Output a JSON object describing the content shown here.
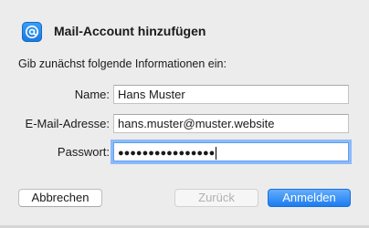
{
  "dialog": {
    "icon": "mail-at-icon",
    "title": "Mail-Account hinzufügen",
    "subtitle": "Gib zunächst folgende Informationen ein:"
  },
  "form": {
    "name_label": "Name:",
    "name_value": "Hans Muster",
    "email_label": "E-Mail-Adresse:",
    "email_value": "hans.muster@muster.website",
    "password_label": "Passwort:",
    "password_masked": "●●●●●●●●●●●●●●●●"
  },
  "buttons": {
    "cancel": "Abbrechen",
    "back": "Zurück",
    "login": "Anmelden"
  },
  "colors": {
    "accent": "#1d7bf0",
    "focus_ring": "#8cbaf7",
    "background": "#ececec"
  }
}
